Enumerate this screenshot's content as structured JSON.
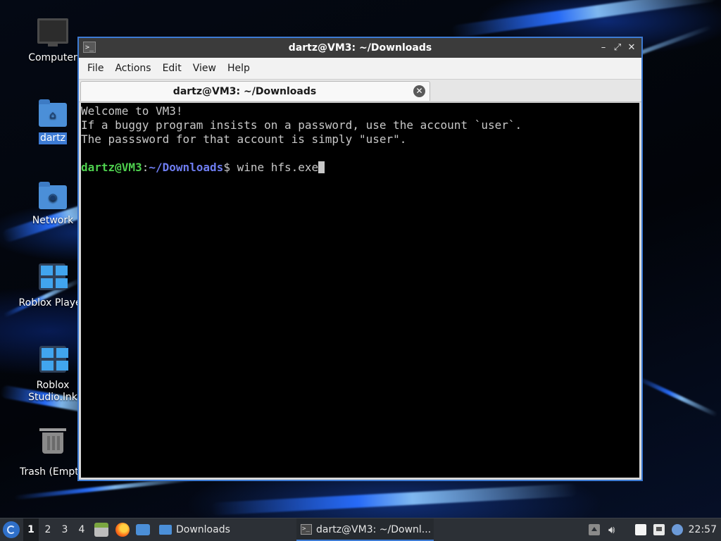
{
  "desktop": {
    "icons": [
      {
        "label": "Computer",
        "icon": "computer-icon"
      },
      {
        "label": "dartz",
        "icon": "home-folder-icon"
      },
      {
        "label": "Network",
        "icon": "network-folder-icon"
      },
      {
        "label": "Roblox Player",
        "icon": "roblox-player-icon"
      },
      {
        "label": "Roblox Studio.lnk",
        "icon": "roblox-studio-icon"
      },
      {
        "label": "Trash (Empty)",
        "icon": "trash-icon"
      }
    ]
  },
  "window": {
    "title": "dartz@VM3: ~/Downloads",
    "controls": {
      "minimize": "–",
      "maximize": "⤢",
      "close": "✕"
    },
    "menu": [
      "File",
      "Actions",
      "Edit",
      "View",
      "Help"
    ],
    "tab": {
      "label": "dartz@VM3: ~/Downloads",
      "close": "✕"
    },
    "terminal": {
      "lines": [
        "Welcome to VM3!",
        "If a buggy program insists on a password, use the account `user`.",
        "The passsword for that account is simply \"user\"."
      ],
      "prompt": {
        "user_host": "dartz@VM3",
        "sep": ":",
        "path": "~/Downloads",
        "symbol": "$",
        "command": " wine hfs.exe"
      }
    }
  },
  "taskbar": {
    "workspaces": [
      "1",
      "2",
      "3",
      "4"
    ],
    "active_workspace": "1",
    "tasks": [
      {
        "label": "Downloads",
        "icon": "folder-icon"
      },
      {
        "label": "dartz@VM3: ~/Downl...",
        "icon": "terminal-icon"
      }
    ],
    "clock": "22:57"
  },
  "colors": {
    "accent": "#3d7bd4",
    "prompt_user": "#4ed04e",
    "prompt_path": "#6e7df0",
    "terminal_bg": "#000000",
    "terminal_fg": "#c8c8c8"
  }
}
